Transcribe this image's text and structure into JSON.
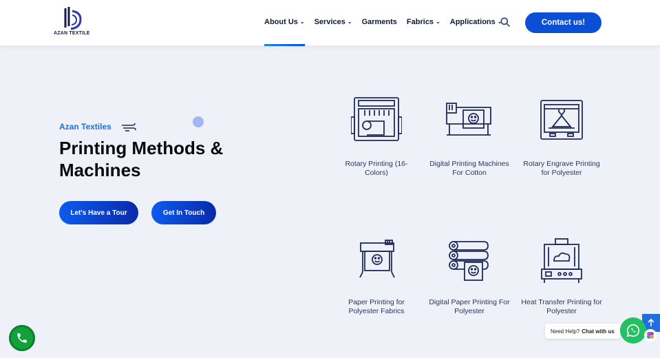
{
  "header": {
    "logo_text": "AZAN TEXTILE",
    "nav": [
      {
        "label": "About Us",
        "has_dropdown": true,
        "active": true
      },
      {
        "label": "Services",
        "has_dropdown": true
      },
      {
        "label": "Garments",
        "has_dropdown": false
      },
      {
        "label": "Fabrics",
        "has_dropdown": true
      },
      {
        "label": "Applications",
        "has_dropdown": true
      }
    ],
    "search_icon": "search-icon",
    "contact_label": "Contact us!"
  },
  "hero": {
    "eyebrow": "Azan Textiles",
    "title": "Printing Methods & Machines",
    "buttons": {
      "tour": "Let's Have a Tour",
      "touch": "Get In Touch"
    }
  },
  "services": [
    {
      "label": "Rotary Printing (16-Colors)",
      "icon": "rotary-printer-icon"
    },
    {
      "label": "Digital Printing Machines For Cotton",
      "icon": "digital-printer-icon"
    },
    {
      "label": "Rotary Engrave Printing for Polyester",
      "icon": "3d-printer-icon"
    },
    {
      "label": "Paper Printing for Polyester Fabrics",
      "icon": "plotter-printer-icon"
    },
    {
      "label": "Digital Paper Printing For Polyester",
      "icon": "paper-rolls-icon"
    },
    {
      "label": "Heat Transfer Printing for Polyester",
      "icon": "heat-press-icon"
    }
  ],
  "floating": {
    "chat_prefix": "Need Help?",
    "chat_label": "Chat with us"
  },
  "colors": {
    "accent": "#0b4fd6",
    "icon_stroke": "#1e2a5a",
    "background": "#eef1f7",
    "whatsapp": "#25c063",
    "call": "#11a33a"
  }
}
